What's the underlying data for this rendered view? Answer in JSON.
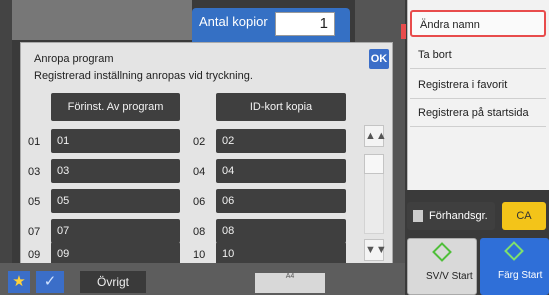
{
  "header": {
    "copies_label": "Antal kopior",
    "copies_value": "1"
  },
  "dialog": {
    "title": "Anropa program",
    "subtitle": "Registrerad inställning anropas vid tryckning.",
    "ok_label": "OK",
    "header_left": "Förinst. Av program",
    "header_right": "ID-kort kopia",
    "rows": [
      {
        "left_num": "01",
        "left_label": "01",
        "right_num": "02",
        "right_label": "02"
      },
      {
        "left_num": "03",
        "left_label": "03",
        "right_num": "04",
        "right_label": "04"
      },
      {
        "left_num": "05",
        "left_label": "05",
        "right_num": "06",
        "right_label": "06"
      },
      {
        "left_num": "07",
        "left_label": "07",
        "right_num": "08",
        "right_label": "08"
      },
      {
        "left_num": "09",
        "left_label": "09",
        "right_num": "10",
        "right_label": "10"
      }
    ],
    "scroll_up": "▲▲",
    "scroll_down": "▼▼"
  },
  "menu": {
    "items": [
      "Ändra namn",
      "Ta bort",
      "Registrera i favorit",
      "Registrera på startsida"
    ]
  },
  "controls": {
    "preview": "Förhandsgr.",
    "ca": "CA",
    "bw_start": "SV/V Start",
    "color_start": "Färg Start",
    "ovrigt": "Övrigt",
    "bottom_tiny": "A4"
  },
  "colors": {
    "accent": "#3b6ec8",
    "highlight": "#e84c4c",
    "ca": "#f3c419"
  }
}
